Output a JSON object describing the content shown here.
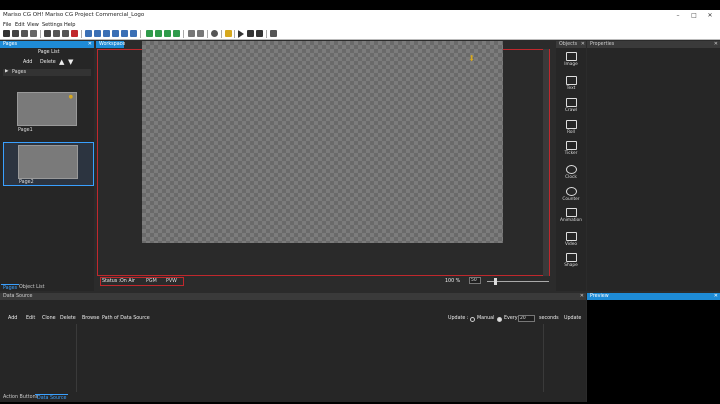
{
  "window": {
    "title": "Mariso CG OH! Mariso CG Project Commercial_Logo",
    "controls": [
      "–",
      "□",
      "✕"
    ]
  },
  "menu": [
    "File",
    "Edit",
    "View",
    "Settings",
    "Help"
  ],
  "pages_panel": {
    "header": "Pages",
    "page_list_title": "Page List",
    "add_label": "Add",
    "delete_label": "Delete",
    "tree_root": "Pages",
    "pages": [
      {
        "label": "Page1"
      },
      {
        "label": "Page2"
      }
    ],
    "tabs": [
      "Pages",
      "Object List"
    ]
  },
  "workspace": {
    "tab": "Workspace",
    "status_label": "Status :",
    "status_value": "On Air",
    "pgm_label": "PGM",
    "pvw_label": "PVW",
    "zoom_label": "100 %",
    "zoom_value": "50",
    "zoom_slider_fraction": 0.12
  },
  "objects_panel": {
    "header": "Objects",
    "tools": [
      {
        "label": "Image",
        "icon": "image-icon"
      },
      {
        "label": "Text",
        "icon": "text-icon"
      },
      {
        "label": "Crawl",
        "icon": "crawl-icon"
      },
      {
        "label": "Roll",
        "icon": "roll-icon"
      },
      {
        "label": "Ticker",
        "icon": "ticker-icon"
      },
      {
        "label": "Clock",
        "icon": "clock-icon"
      },
      {
        "label": "Counter",
        "icon": "counter-icon"
      },
      {
        "label": "Animation",
        "icon": "animation-icon"
      },
      {
        "label": "Video",
        "icon": "video-icon"
      },
      {
        "label": "Shape",
        "icon": "shape-icon"
      }
    ]
  },
  "properties_panel": {
    "header": "Properties"
  },
  "data_source": {
    "header": "Data Source",
    "buttons": [
      "Add",
      "Edit",
      "Clone",
      "Delete"
    ],
    "browse_label": "Browse",
    "path_label": "Path of Data Source",
    "update_label": "Update :",
    "manual_label": "Manual",
    "every_label": "Every",
    "interval_value": "20",
    "seconds_label": "seconds",
    "update_button": "Update",
    "tabs": [
      "Action Buttons",
      "Data Source"
    ]
  },
  "preview_panel": {
    "header": "Preview"
  },
  "colors": {
    "accent": "#1e8bd6",
    "selection_border": "#c0282d",
    "panel": "#262626",
    "app_bg": "#2b2b2b"
  }
}
